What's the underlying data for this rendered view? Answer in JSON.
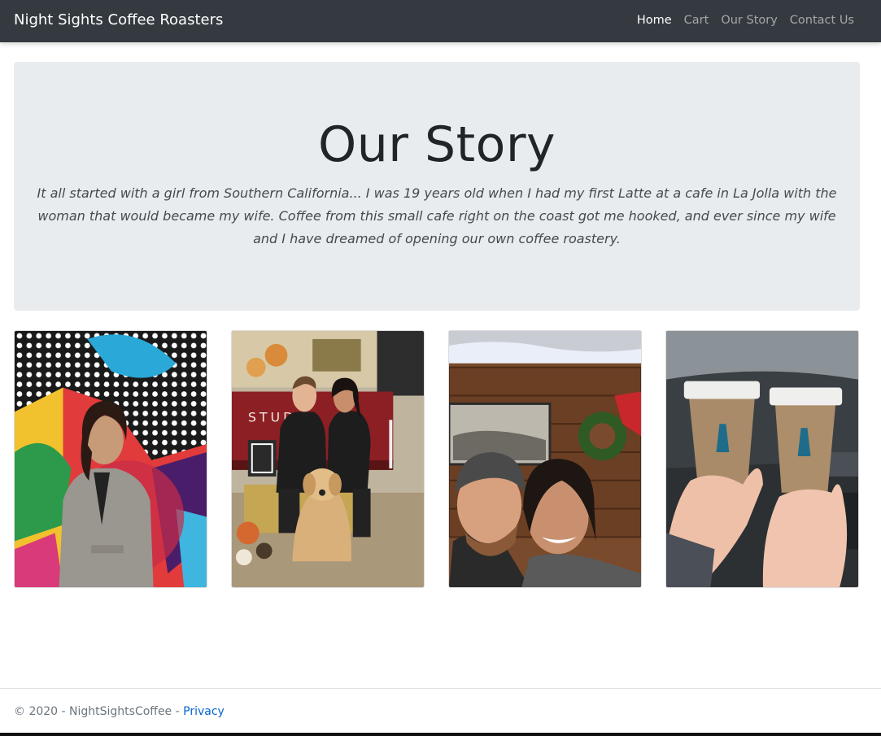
{
  "navbar": {
    "brand": "Night Sights Coffee Roasters",
    "links": [
      "Home",
      "Cart",
      "Our Story",
      "Contact Us"
    ],
    "active": "Home"
  },
  "hero": {
    "title": "Our Story",
    "lead": "It all started with a girl from Southern California... I was 19 years old when I had my first Latte at a cafe in La Jolla with the woman that would became my wife. Coffee from this small cafe right on the coast got me hooked, and ever since my wife and I have dreamed of opening our own coffee roastery."
  },
  "gallery": {
    "photos": [
      {
        "name": "photo-woman-mural"
      },
      {
        "name": "photo-couple-dog-truck"
      },
      {
        "name": "photo-couple-selfie"
      },
      {
        "name": "photo-coffee-cups"
      }
    ],
    "truck_text": "STUD"
  },
  "footer": {
    "prefix": "© 2020 - NightSightsCoffee - ",
    "privacy": "Privacy"
  },
  "colors": {
    "navbar": "#343a40",
    "jumbotron": "#e9ecef",
    "link": "#0366d6"
  }
}
